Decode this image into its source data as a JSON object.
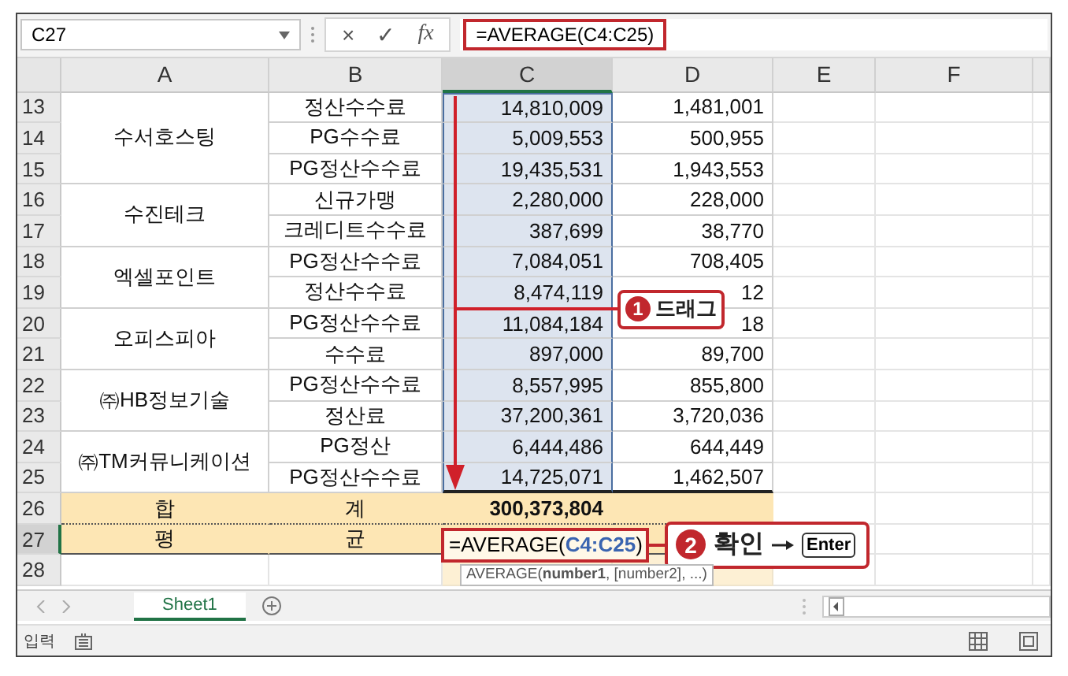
{
  "formula_bar": {
    "name_box": "C27",
    "cancel": "×",
    "enter": "✓",
    "fx": "fx",
    "formula": "=AVERAGE(C4:C25)"
  },
  "columns": [
    {
      "label": "A",
      "selected": false
    },
    {
      "label": "B",
      "selected": false
    },
    {
      "label": "C",
      "selected": true
    },
    {
      "label": "D",
      "selected": false
    },
    {
      "label": "E",
      "selected": false
    },
    {
      "label": "F",
      "selected": false
    }
  ],
  "groups": [
    {
      "company": "수서호스팅",
      "rows": [
        {
          "number": "13",
          "item": "정산수수료",
          "amount": "14,810,009",
          "fee": "1,481,001"
        },
        {
          "number": "14",
          "item": "PG수수료",
          "amount": "5,009,553",
          "fee": "500,955"
        },
        {
          "number": "15",
          "item": "PG정산수수료",
          "amount": "19,435,531",
          "fee": "1,943,553"
        }
      ]
    },
    {
      "company": "수진테크",
      "rows": [
        {
          "number": "16",
          "item": "신규가맹",
          "amount": "2,280,000",
          "fee": "228,000"
        },
        {
          "number": "17",
          "item": "크레디트수수료",
          "amount": "387,699",
          "fee": "38,770"
        }
      ]
    },
    {
      "company": "엑셀포인트",
      "rows": [
        {
          "number": "18",
          "item": "PG정산수수료",
          "amount": "7,084,051",
          "fee": "708,405"
        },
        {
          "number": "19",
          "item": "정산수수료",
          "amount": "8,474,119",
          "fee": "12"
        }
      ]
    },
    {
      "company": "오피스피아",
      "rows": [
        {
          "number": "20",
          "item": "PG정산수수료",
          "amount": "11,084,184",
          "fee": "18"
        },
        {
          "number": "21",
          "item": "수수료",
          "amount": "897,000",
          "fee": "89,700"
        }
      ]
    },
    {
      "company": "㈜HB정보기술",
      "rows": [
        {
          "number": "22",
          "item": "PG정산수수료",
          "amount": "8,557,995",
          "fee": "855,800"
        },
        {
          "number": "23",
          "item": "정산료",
          "amount": "37,200,361",
          "fee": "3,720,036"
        }
      ]
    },
    {
      "company": "㈜TM커뮤니케이션",
      "rows": [
        {
          "number": "24",
          "item": "PG정산",
          "amount": "6,444,486",
          "fee": "644,449"
        },
        {
          "number": "25",
          "item": "PG정산수수료",
          "amount": "14,725,071",
          "fee": "1,462,507"
        }
      ]
    }
  ],
  "total_row": {
    "number": "26",
    "label_a": "합",
    "label_b": "계",
    "value": "300,373,804",
    "selected": false
  },
  "average_row": {
    "number": "27",
    "label_a": "평",
    "label_b": "균",
    "selected": true,
    "edit_prefix": "=AVERAGE(",
    "edit_ref": "C4:C25",
    "edit_suffix": ")"
  },
  "empty_row": {
    "number": "28",
    "selected": false
  },
  "tooltip": "AVERAGE(**number1**, [number2], ...)",
  "callouts": [
    {
      "number": "1",
      "text": "드래그"
    },
    {
      "number": "2",
      "text": "확인",
      "key": "Enter"
    }
  ],
  "sheet_tabs": [
    {
      "label": "Sheet1",
      "selected": true
    }
  ],
  "status_bar": {
    "mode": "입력"
  }
}
